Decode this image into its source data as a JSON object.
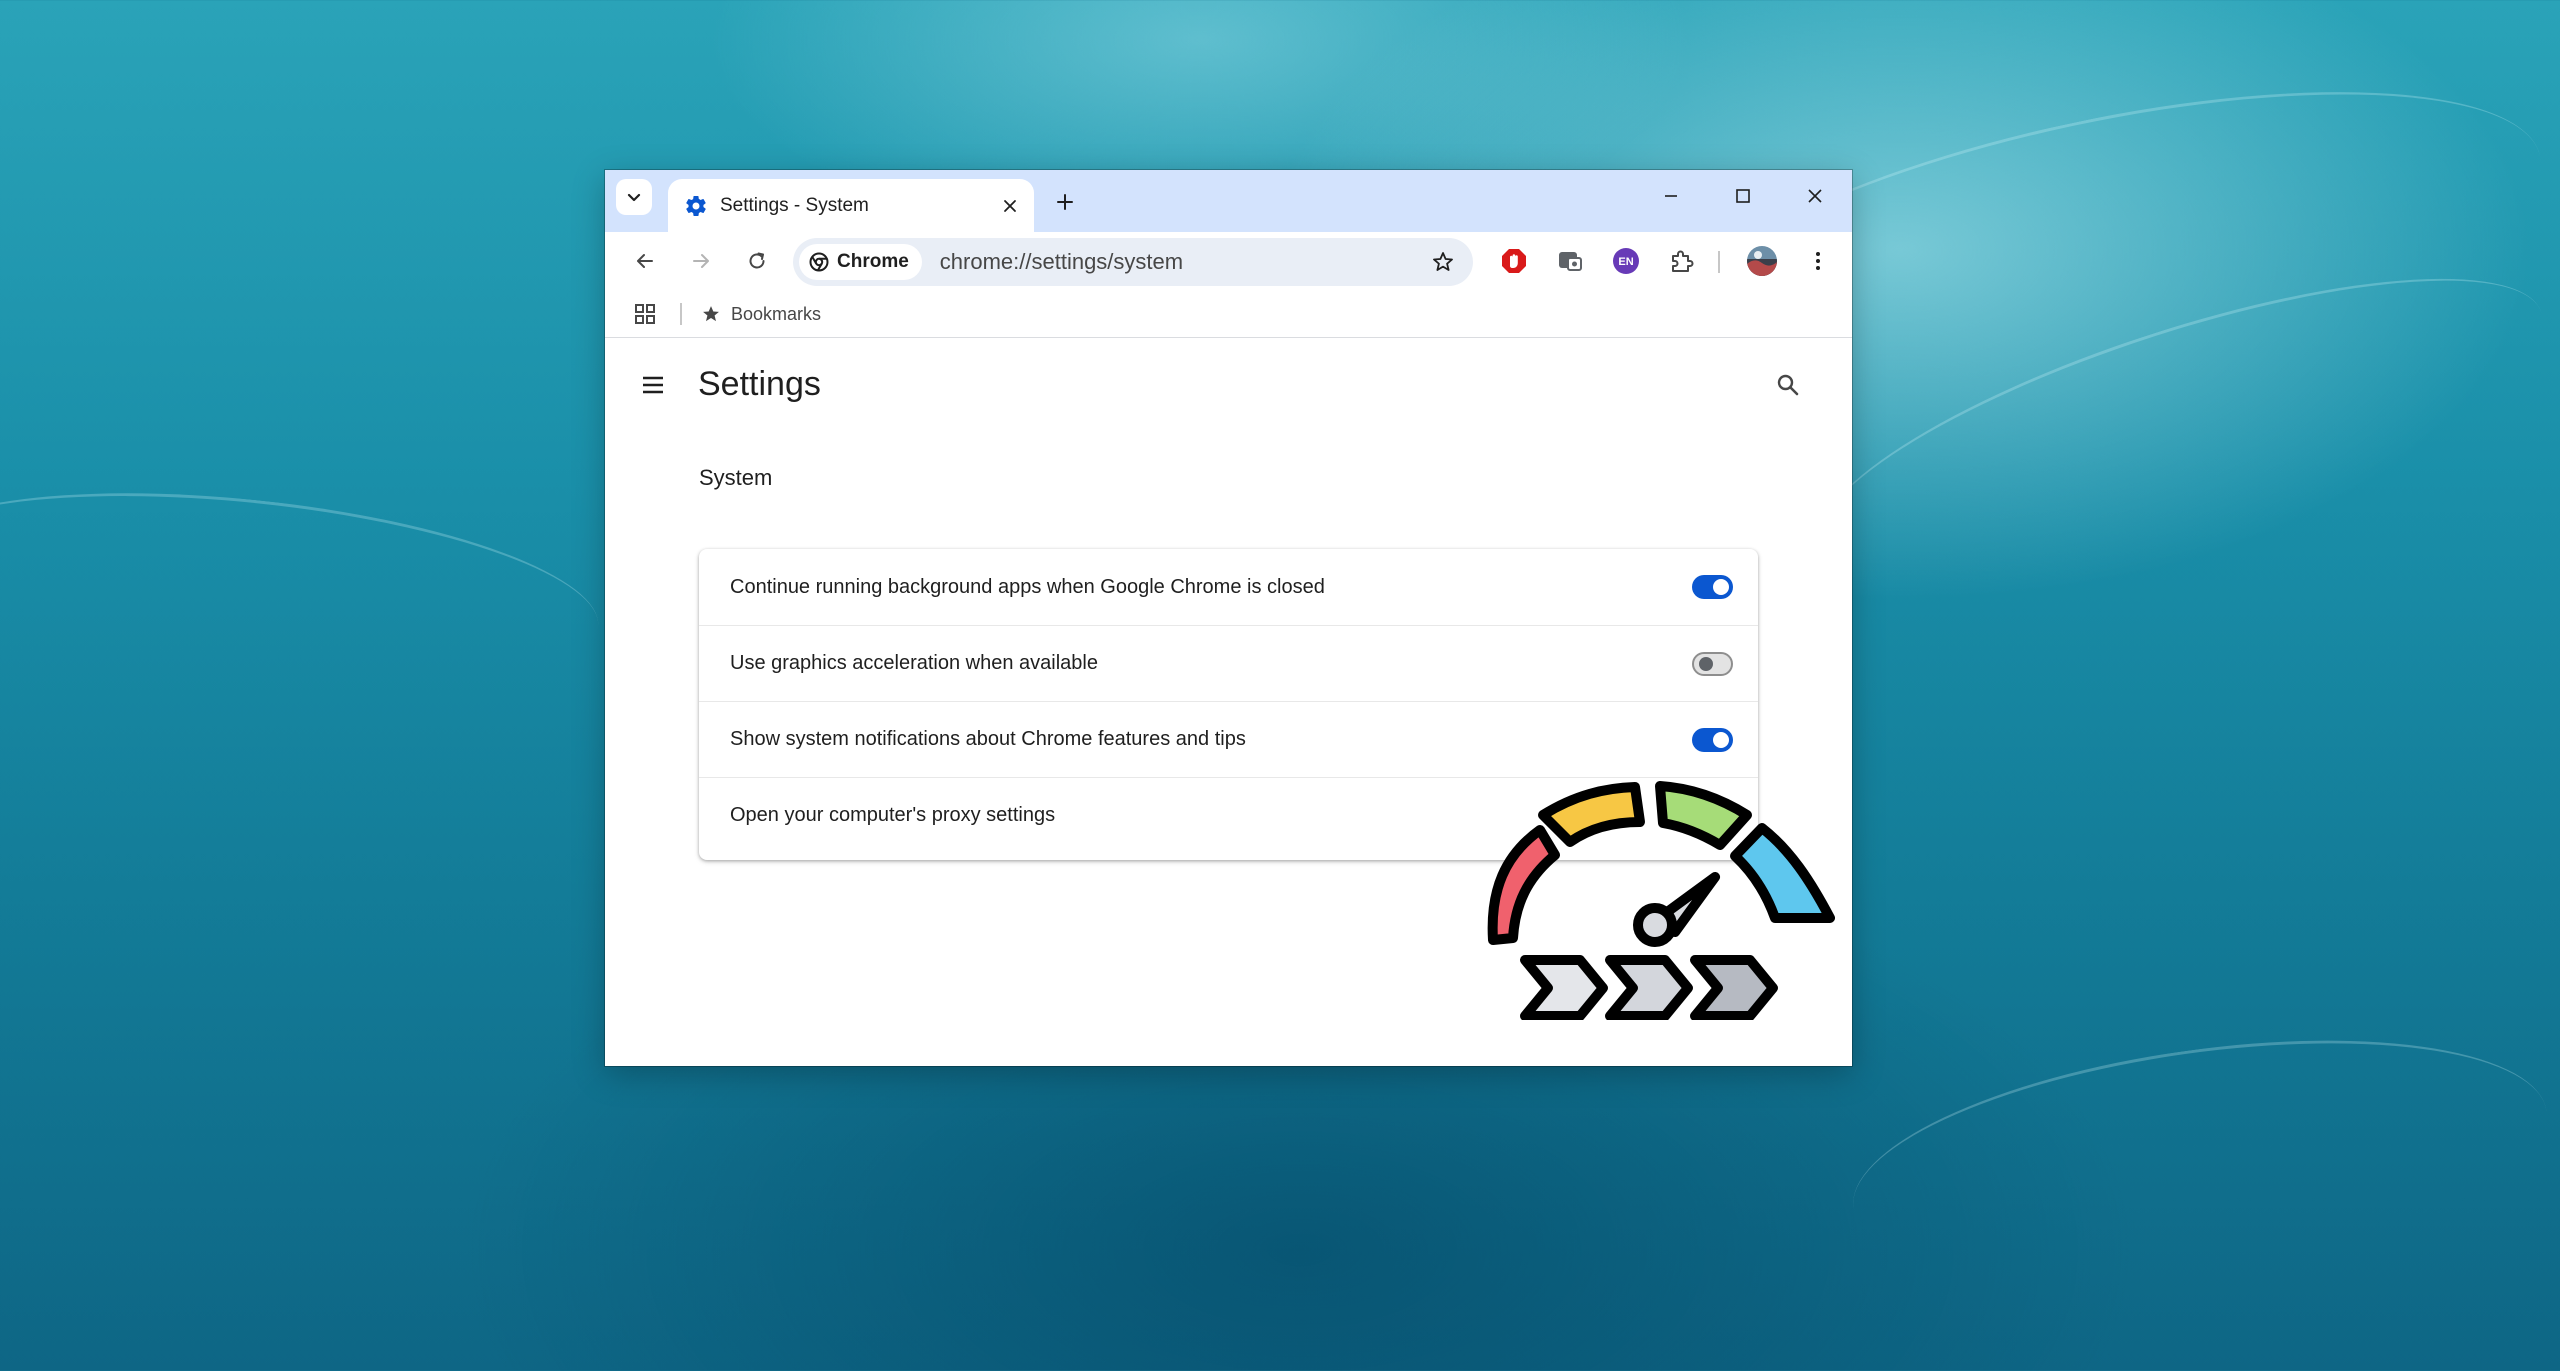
{
  "browser": {
    "tab": {
      "title": "Settings - System"
    },
    "omnibox": {
      "chip_label": "Chrome",
      "url": "chrome://settings/system"
    },
    "extensions": [
      {
        "name": "adblock-icon",
        "color": "#d91a1a"
      },
      {
        "name": "screen-capture-icon",
        "color": "#5f6368"
      },
      {
        "name": "language-extension-icon",
        "color": "#673ab7",
        "label": "EN"
      },
      {
        "name": "puzzle-icon",
        "color": "#474747"
      }
    ],
    "bookmarks_bar": {
      "item_label": "Bookmarks"
    }
  },
  "settings": {
    "title": "Settings",
    "section_title": "System",
    "rows": [
      {
        "label": "Continue running background apps when Google Chrome is closed",
        "toggle": "on"
      },
      {
        "label": "Use graphics acceleration when available",
        "toggle": "off"
      },
      {
        "label": "Show system notifications about Chrome features and tips",
        "toggle": "on"
      },
      {
        "label": "Open your computer's proxy settings"
      }
    ]
  },
  "colors": {
    "accent": "#0b57d0",
    "titlebar": "#d3e3fd",
    "omnibox": "#e9eef6"
  }
}
